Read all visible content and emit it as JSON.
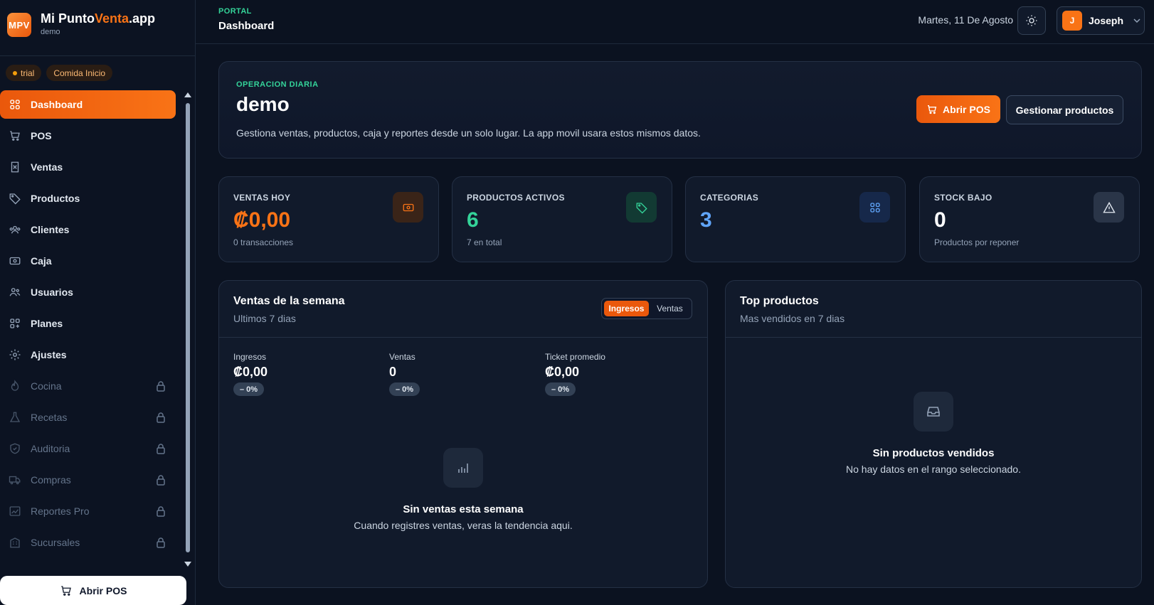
{
  "brand": {
    "logo": "MPV",
    "name_part1": "Mi Punto",
    "name_part2": "Venta",
    "name_part3": ".app",
    "subtitle": "demo"
  },
  "chips": {
    "plan": "trial",
    "business": "Comida Inicio"
  },
  "nav": [
    {
      "label": "Dashboard",
      "icon": "grid-icon",
      "active": true,
      "locked": false
    },
    {
      "label": "POS",
      "icon": "cart-icon",
      "locked": false
    },
    {
      "label": "Ventas",
      "icon": "receipt-icon",
      "locked": false
    },
    {
      "label": "Productos",
      "icon": "tag-icon",
      "locked": false
    },
    {
      "label": "Clientes",
      "icon": "users-icon",
      "locked": false
    },
    {
      "label": "Caja",
      "icon": "cash-icon",
      "locked": false
    },
    {
      "label": "Usuarios",
      "icon": "user-group-icon",
      "locked": false
    },
    {
      "label": "Planes",
      "icon": "grid-plus-icon",
      "locked": false
    },
    {
      "label": "Ajustes",
      "icon": "gear-icon",
      "locked": false
    },
    {
      "label": "Cocina",
      "icon": "flame-icon",
      "locked": true
    },
    {
      "label": "Recetas",
      "icon": "flask-icon",
      "locked": true
    },
    {
      "label": "Auditoria",
      "icon": "shield-icon",
      "locked": true
    },
    {
      "label": "Compras",
      "icon": "truck-icon",
      "locked": true
    },
    {
      "label": "Reportes Pro",
      "icon": "chart-icon",
      "locked": true
    },
    {
      "label": "Sucursales",
      "icon": "building-icon",
      "locked": true
    }
  ],
  "sidebar_footer": {
    "open_pos_label": "Abrir POS"
  },
  "header": {
    "crumb": "PORTAL",
    "title": "Dashboard",
    "date": "Martes, 11 De Agosto",
    "user_initial": "J",
    "user_name": "Joseph"
  },
  "hero": {
    "tag": "OPERACION DIARIA",
    "title": "demo",
    "description": "Gestiona ventas, productos, caja y reportes desde un solo lugar. La app movil usara estos mismos datos.",
    "primary_button": "Abrir POS",
    "secondary_button": "Gestionar productos"
  },
  "stats": [
    {
      "label": "VENTAS HOY",
      "value": "₡0,00",
      "sub": "0 transacciones",
      "color": "#f97316",
      "icon": "cash-icon"
    },
    {
      "label": "PRODUCTOS ACTIVOS",
      "value": "6",
      "sub": "7 en total",
      "color": "#34d399",
      "icon": "tag-icon"
    },
    {
      "label": "CATEGORIAS",
      "value": "3",
      "sub": "",
      "color": "#60a5fa",
      "icon": "grid-icon"
    },
    {
      "label": "STOCK BAJO",
      "value": "0",
      "sub": "Productos por reponer",
      "color": "#ffffff",
      "icon": "alert-icon"
    }
  ],
  "weekly": {
    "title": "Ventas de la semana",
    "subtitle": "Ultimos 7 dias",
    "toggle_on": "Ingresos",
    "toggle_off": "Ventas",
    "metrics": [
      {
        "label": "Ingresos",
        "value": "₡0,00",
        "badge": "0%"
      },
      {
        "label": "Ventas",
        "value": "0",
        "badge": "0%"
      },
      {
        "label": "Ticket promedio",
        "value": "₡0,00",
        "badge": "0%"
      }
    ],
    "empty_title": "Sin ventas esta semana",
    "empty_desc": "Cuando registres ventas, veras la tendencia aqui."
  },
  "top_products": {
    "title": "Top productos",
    "subtitle": "Mas vendidos en 7 dias",
    "empty_title": "Sin productos vendidos",
    "empty_desc": "No hay datos en el rango seleccionado."
  }
}
